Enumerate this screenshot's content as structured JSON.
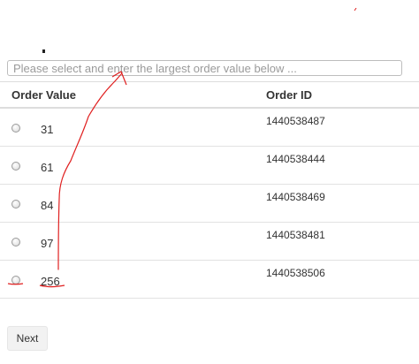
{
  "search": {
    "placeholder": "Please select and enter the largest order value below ..."
  },
  "table": {
    "headers": {
      "order_value": "Order Value",
      "order_id": "Order ID"
    },
    "rows": [
      {
        "value": "31",
        "id": "1440538487"
      },
      {
        "value": "61",
        "id": "1440538444"
      },
      {
        "value": "84",
        "id": "1440538469"
      },
      {
        "value": "97",
        "id": "1440538481"
      },
      {
        "value": "256",
        "id": "1440538506"
      }
    ]
  },
  "buttons": {
    "next_label": "Next"
  },
  "colors": {
    "annotation": "#e02020",
    "border": "#dddddd",
    "button_bg": "#f2f2f2"
  }
}
